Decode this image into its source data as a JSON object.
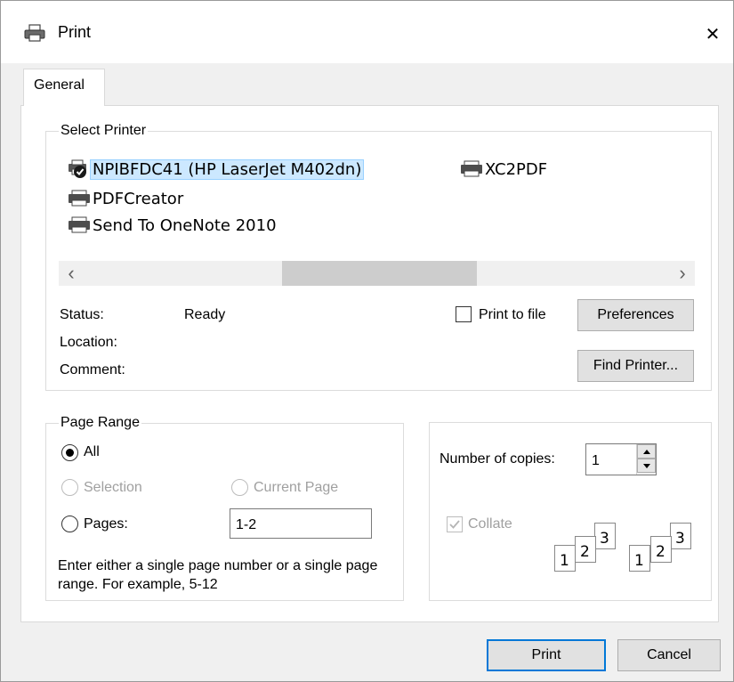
{
  "window": {
    "title": "Print",
    "close_glyph": "✕"
  },
  "tabs": [
    {
      "label": "General"
    }
  ],
  "select_printer": {
    "legend": "Select Printer",
    "printers": [
      {
        "name": "NPIBFDC41 (HP LaserJet M402dn)",
        "selected": true,
        "default": true,
        "icon": "printer-icon"
      },
      {
        "name": "XC2PDF",
        "icon": "printer-icon"
      },
      {
        "name": "PDFCreator",
        "icon": "printer-icon"
      },
      {
        "name": "Send To OneNote 2010",
        "icon": "printer-icon"
      }
    ],
    "scroll_left": "‹",
    "scroll_right": "›",
    "status_label": "Status:",
    "status_value": "Ready",
    "location_label": "Location:",
    "comment_label": "Comment:",
    "print_to_file_label": "Print to file",
    "print_to_file_checked": false,
    "preferences_label": "Preferences",
    "find_printer_label": "Find Printer..."
  },
  "page_range": {
    "legend": "Page Range",
    "all_label": "All",
    "selection_label": "Selection",
    "current_page_label": "Current Page",
    "pages_label": "Pages:",
    "pages_value": "1-2",
    "selected_option": "All",
    "hint": "Enter either a single page number or a single page range.  For example, 5-12"
  },
  "copies": {
    "label": "Number of copies:",
    "value": "1",
    "collate_label": "Collate",
    "collate_checked": true,
    "collate_disabled": true,
    "collate_pages": [
      "1",
      "2",
      "3"
    ]
  },
  "footer": {
    "print_label": "Print",
    "cancel_label": "Cancel"
  },
  "colors": {
    "accent": "#0078d7",
    "selection_bg": "#cce8ff",
    "disabled_text": "#a0a0a0"
  }
}
